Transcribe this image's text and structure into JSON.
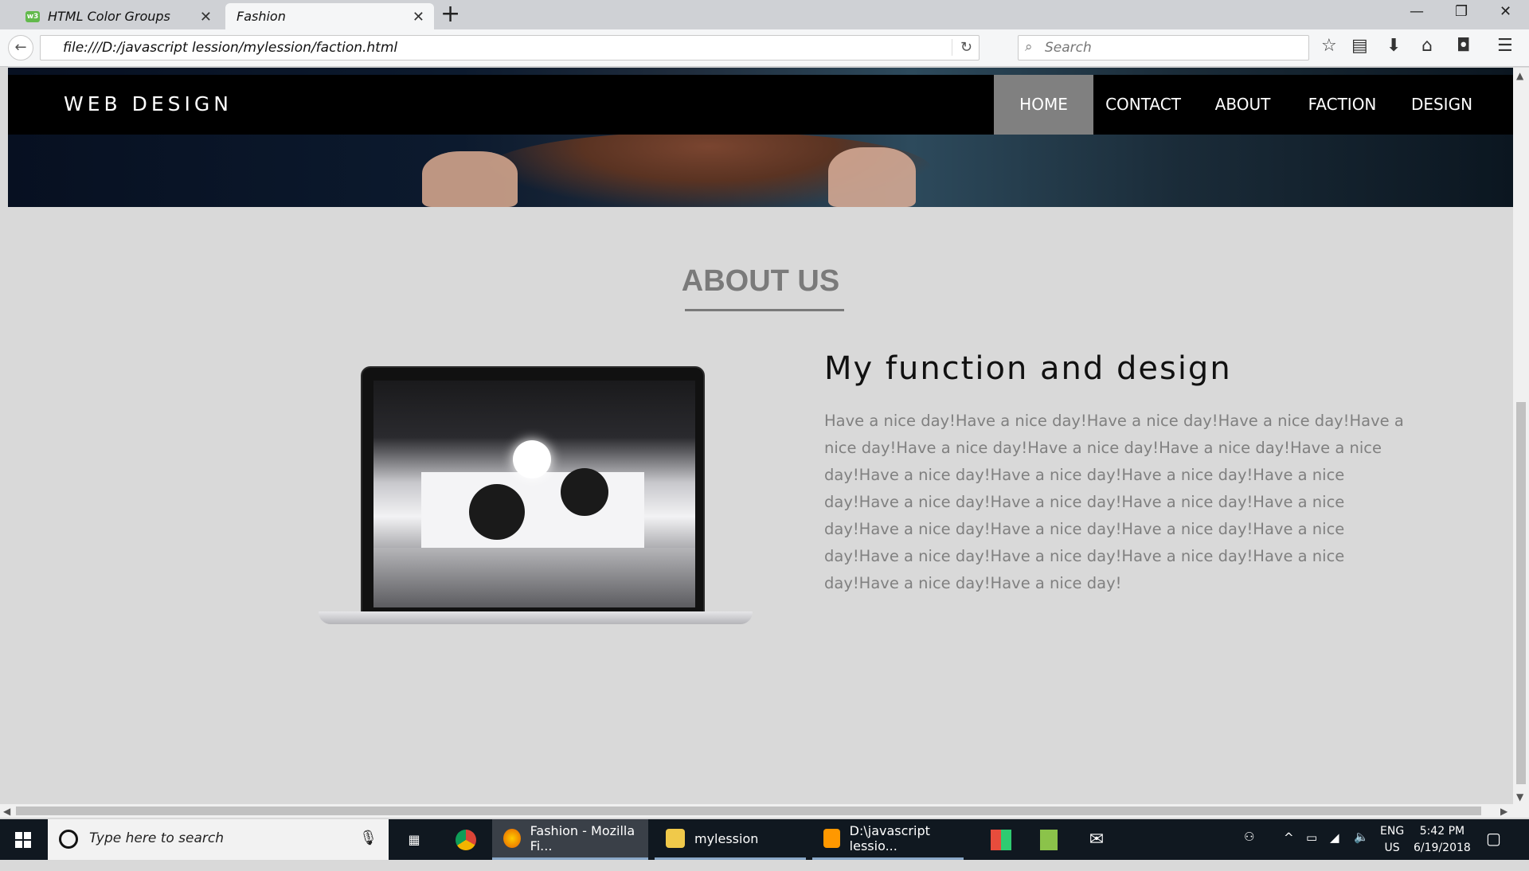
{
  "browser": {
    "tabs": [
      {
        "label": "HTML Color Groups",
        "active": false
      },
      {
        "label": "Fashion",
        "active": true
      }
    ],
    "url": "file:///D:/javascript lession/mylession/faction.html",
    "search_placeholder": "Search"
  },
  "site": {
    "logo": "WEB DESIGN",
    "menu": [
      "HOME",
      "CONTACT",
      "ABOUT",
      "FACTION",
      "DESIGN"
    ],
    "active_menu": "HOME",
    "about_title": "ABOUT US",
    "function_title": "My function and design",
    "function_text": "Have a nice day!Have a nice day!Have a nice day!Have a nice day!Have a nice day!Have a nice day!Have a nice day!Have a nice day!Have a nice day!Have a nice day!Have a nice day!Have a nice day!Have a nice day!Have a nice day!Have a nice day!Have a nice day!Have a nice day!Have a nice day!Have a nice day!Have a nice day!Have a nice day!Have a nice day!Have a nice day!Have a nice day!Have a nice day!Have a nice day!Have a nice day!"
  },
  "taskbar": {
    "search_placeholder": "Type here to search",
    "apps": [
      {
        "label": "Fashion - Mozilla Fi...",
        "icon": "firefox-icon"
      },
      {
        "label": "mylession",
        "icon": "folder-icon"
      },
      {
        "label": "D:\\javascript lessio...",
        "icon": "sublime-icon"
      }
    ],
    "lang": "ENG",
    "region": "US",
    "time": "5:42 PM",
    "date": "6/19/2018"
  },
  "colors": {
    "nav_bg": "#000000",
    "nav_active": "#808080",
    "page_bg": "#d9d9d9",
    "heading_gray": "#7a7a7a"
  }
}
